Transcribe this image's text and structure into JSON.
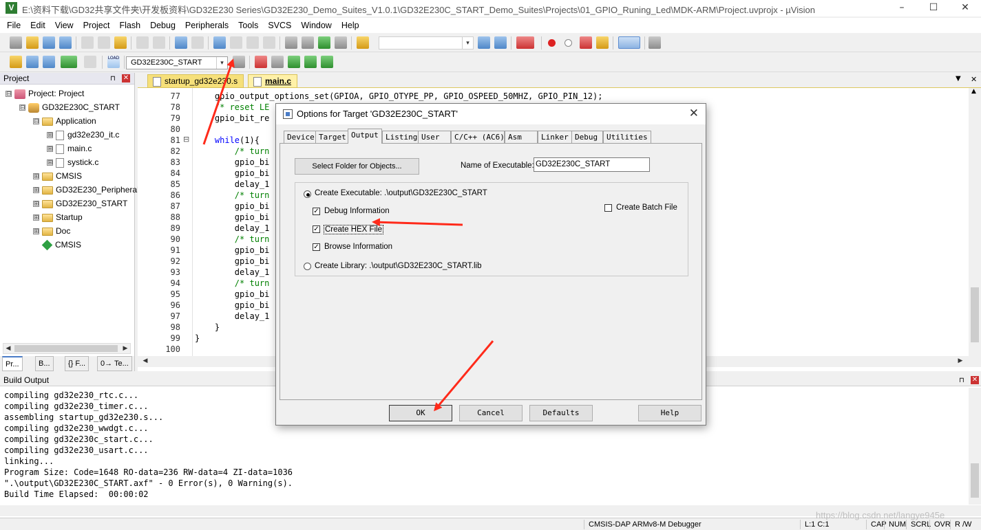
{
  "window": {
    "title": "E:\\资料下载\\GD32共享文件夹\\开发板资料\\GD32E230 Series\\GD32E230_Demo_Suites_V1.0.1\\GD32E230C_START_Demo_Suites\\Projects\\01_GPIO_Runing_Led\\MDK-ARM\\Project.uvprojx - µVision",
    "app_icon_letter": "V",
    "controls": [
      "–",
      "☐",
      "✕"
    ]
  },
  "menubar": [
    "File",
    "Edit",
    "View",
    "Project",
    "Flash",
    "Debug",
    "Peripherals",
    "Tools",
    "SVCS",
    "Window",
    "Help"
  ],
  "toolbar2": {
    "target_select": "GD32E230C_START",
    "load_label": "LOAD"
  },
  "project_panel": {
    "title": "Project",
    "pin": "⊓",
    "close": "✕",
    "tree": [
      {
        "label": "Project: Project",
        "level": 0,
        "kind": "project",
        "exp": "⊟"
      },
      {
        "label": "GD32E230C_START",
        "level": 1,
        "kind": "target",
        "exp": "⊟"
      },
      {
        "label": "Application",
        "level": 2,
        "kind": "folder",
        "exp": "⊟"
      },
      {
        "label": "gd32e230_it.c",
        "level": 3,
        "kind": "file",
        "exp": "⊞"
      },
      {
        "label": "main.c",
        "level": 3,
        "kind": "file",
        "exp": "⊞"
      },
      {
        "label": "systick.c",
        "level": 3,
        "kind": "file",
        "exp": "⊞"
      },
      {
        "label": "CMSIS",
        "level": 2,
        "kind": "folder",
        "exp": "⊞"
      },
      {
        "label": "GD32E230_Peripherals",
        "level": 2,
        "kind": "folder",
        "exp": "⊞"
      },
      {
        "label": "GD32E230_START",
        "level": 2,
        "kind": "folder",
        "exp": "⊞"
      },
      {
        "label": "Startup",
        "level": 2,
        "kind": "folder",
        "exp": "⊞"
      },
      {
        "label": "Doc",
        "level": 2,
        "kind": "folder",
        "exp": "⊞"
      },
      {
        "label": "CMSIS",
        "level": 2,
        "kind": "diamond",
        "exp": ""
      }
    ],
    "bottom_tabs": [
      "Pr...",
      "B...",
      "{} F...",
      "0→ Te..."
    ]
  },
  "editor": {
    "tabs": [
      {
        "label": "startup_gd32e230.s",
        "active": false
      },
      {
        "label": "main.c",
        "active": true
      }
    ],
    "line_numbers": [
      "77",
      "78",
      "79",
      "80",
      "81",
      "82",
      "83",
      "84",
      "85",
      "86",
      "87",
      "88",
      "89",
      "90",
      "91",
      "92",
      "93",
      "94",
      "95",
      "96",
      "97",
      "98",
      "99",
      "100"
    ],
    "code_lines": [
      "    gpio_output_options_set(GPIOA, GPIO_OTYPE_PP, GPIO_OSPEED_50MHZ, GPIO_PIN_12);",
      "    /* reset LE",
      "    gpio_bit_re",
      "",
      "    while(1){",
      "        /* turn",
      "        gpio_bi",
      "        gpio_bi",
      "        delay_1",
      "        /* turn",
      "        gpio_bi",
      "        gpio_bi",
      "        delay_1",
      "        /* turn",
      "        gpio_bi",
      "        gpio_bi",
      "        delay_1",
      "        /* turn",
      "        gpio_bi",
      "        gpio_bi",
      "        delay_1",
      "    }",
      "}",
      ""
    ],
    "fold_marker": "⊟"
  },
  "build_output": {
    "title": "Build Output",
    "lines": [
      "compiling gd32e230_rtc.c...",
      "compiling gd32e230_timer.c...",
      "assembling startup_gd32e230.s...",
      "compiling gd32e230_wwdgt.c...",
      "compiling gd32e230c_start.c...",
      "compiling gd32e230_usart.c...",
      "linking...",
      "Program Size: Code=1648 RO-data=236 RW-data=4 ZI-data=1036",
      "\".\\output\\GD32E230C_START.axf\" - 0 Error(s), 0 Warning(s).",
      "Build Time Elapsed:  00:00:02"
    ]
  },
  "statusbar": {
    "debugger": "CMSIS-DAP ARMv8-M Debugger",
    "position": "L:1 C:1",
    "indicators": [
      "CAP",
      "NUM",
      "SCRL",
      "OVR",
      "R /W"
    ],
    "watermark": "https://blog.csdn.net/langye945e"
  },
  "dialog": {
    "title": "Options for Target 'GD32E230C_START'",
    "close": "✕",
    "tabs": [
      "Device",
      "Target",
      "Output",
      "Listing",
      "User",
      "C/C++ (AC6)",
      "Asm",
      "Linker",
      "Debug",
      "Utilities"
    ],
    "active_tab": "Output",
    "select_folder_button": "Select Folder for Objects...",
    "name_exec_label": "Name of Executable:",
    "name_exec_value": "GD32E230C_START",
    "create_exec_label": "Create Executable:  .\\output\\GD32E230C_START",
    "debug_info_label": "Debug Information",
    "create_hex_label": "Create HEX File",
    "browse_info_label": "Browse Information",
    "create_lib_label": "Create Library:  .\\output\\GD32E230C_START.lib",
    "create_batch_label": "Create Batch File",
    "check_mark": "✓",
    "buttons": {
      "ok": "OK",
      "cancel": "Cancel",
      "defaults": "Defaults",
      "help": "Help"
    }
  },
  "colors": {
    "annotation_arrow": "#ff2a1a",
    "active_tab_bg": "#fff1a8",
    "tab_strip_accent": "#f6e07a"
  }
}
